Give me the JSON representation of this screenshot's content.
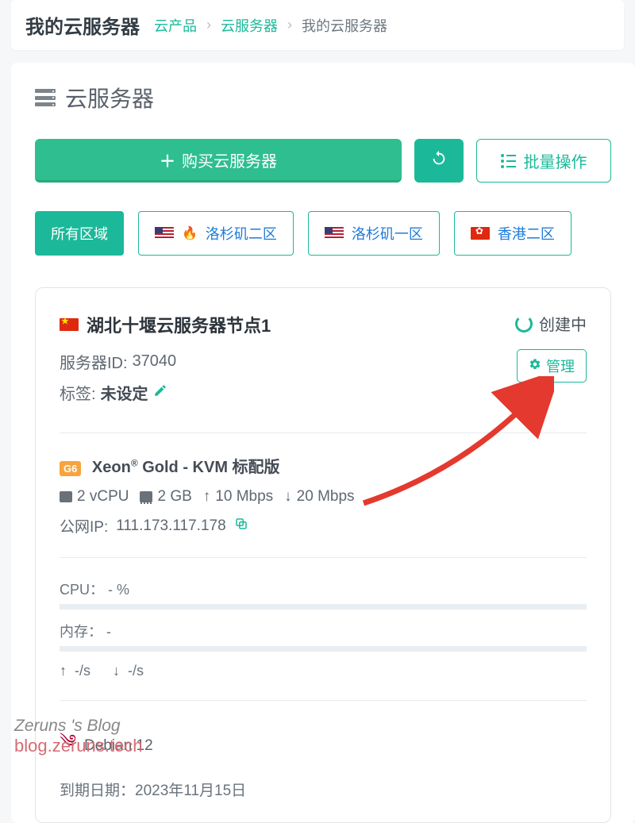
{
  "header": {
    "title": "我的云服务器",
    "breadcrumb": {
      "l1": "云产品",
      "l2": "云服务器",
      "current": "我的云服务器"
    }
  },
  "section_title": "云服务器",
  "toolbar": {
    "buy_label": "购买云服务器",
    "batch_label": "批量操作"
  },
  "filters": {
    "all": "所有区域",
    "la2": "洛杉矶二区",
    "la1": "洛杉矶一区",
    "hk2": "香港二区"
  },
  "card": {
    "name": "湖北十堰云服务器节点1",
    "status": "创建中",
    "server_id_label": "服务器ID:",
    "server_id": "37040",
    "tag_label": "标签:",
    "tag_value": "未设定",
    "manage_label": "管理",
    "spec": {
      "badge": "G6",
      "title_prefix": "Xeon",
      "title_suffix": " Gold - KVM 标配版",
      "cpu": "2 vCPU",
      "mem": "2 GB",
      "up": "10 Mbps",
      "down": "20 Mbps",
      "ip_label": "公网IP:",
      "ip": "111.173.117.178"
    },
    "usage": {
      "cpu_label": "CPU：",
      "cpu_value": "- %",
      "mem_label": "内存：",
      "mem_value": "-",
      "up_speed": "-/s",
      "down_speed": "-/s"
    },
    "os": "Debian 12",
    "expiry_label": "到期日期：",
    "expiry": "2023年11月15日"
  },
  "watermark": {
    "line1": "Zeruns 's Blog",
    "line2": "blog.zeruns.tech"
  }
}
